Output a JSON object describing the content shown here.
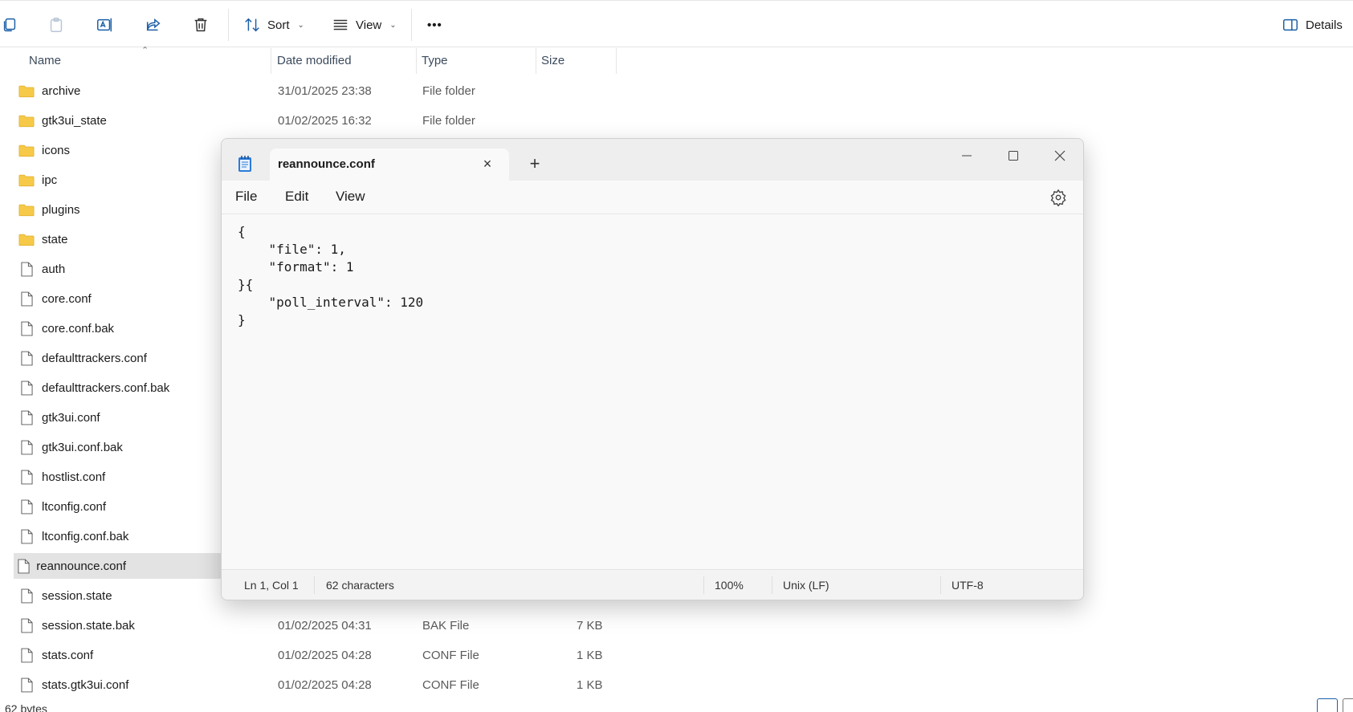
{
  "toolbar": {
    "sort_label": "Sort",
    "view_label": "View",
    "more_label": "•••",
    "details_label": "Details"
  },
  "columns": {
    "name": "Name",
    "date": "Date modified",
    "type": "Type",
    "size": "Size"
  },
  "files": [
    {
      "name": "archive",
      "date": "31/01/2025 23:38",
      "type": "File folder",
      "size": "",
      "kind": "folder"
    },
    {
      "name": "gtk3ui_state",
      "date": "01/02/2025 16:32",
      "type": "File folder",
      "size": "",
      "kind": "folder"
    },
    {
      "name": "icons",
      "date": "",
      "type": "",
      "size": "",
      "kind": "folder"
    },
    {
      "name": "ipc",
      "date": "",
      "type": "",
      "size": "",
      "kind": "folder"
    },
    {
      "name": "plugins",
      "date": "",
      "type": "",
      "size": "",
      "kind": "folder"
    },
    {
      "name": "state",
      "date": "",
      "type": "",
      "size": "",
      "kind": "folder"
    },
    {
      "name": "auth",
      "date": "",
      "type": "",
      "size": "",
      "kind": "file"
    },
    {
      "name": "core.conf",
      "date": "",
      "type": "",
      "size": "",
      "kind": "file"
    },
    {
      "name": "core.conf.bak",
      "date": "",
      "type": "",
      "size": "",
      "kind": "file"
    },
    {
      "name": "defaulttrackers.conf",
      "date": "",
      "type": "",
      "size": "",
      "kind": "file"
    },
    {
      "name": "defaulttrackers.conf.bak",
      "date": "",
      "type": "",
      "size": "",
      "kind": "file"
    },
    {
      "name": "gtk3ui.conf",
      "date": "",
      "type": "",
      "size": "",
      "kind": "file"
    },
    {
      "name": "gtk3ui.conf.bak",
      "date": "",
      "type": "",
      "size": "",
      "kind": "file"
    },
    {
      "name": "hostlist.conf",
      "date": "",
      "type": "",
      "size": "",
      "kind": "file"
    },
    {
      "name": "ltconfig.conf",
      "date": "",
      "type": "",
      "size": "",
      "kind": "file"
    },
    {
      "name": "ltconfig.conf.bak",
      "date": "",
      "type": "",
      "size": "",
      "kind": "file"
    },
    {
      "name": "reannounce.conf",
      "date": "",
      "type": "",
      "size": "",
      "kind": "file",
      "selected": true
    },
    {
      "name": "session.state",
      "date": "",
      "type": "",
      "size": "",
      "kind": "file"
    },
    {
      "name": "session.state.bak",
      "date": "01/02/2025 04:31",
      "type": "BAK File",
      "size": "7 KB",
      "kind": "file"
    },
    {
      "name": "stats.conf",
      "date": "01/02/2025 04:28",
      "type": "CONF File",
      "size": "1 KB",
      "kind": "file"
    },
    {
      "name": "stats.gtk3ui.conf",
      "date": "01/02/2025 04:28",
      "type": "CONF File",
      "size": "1 KB",
      "kind": "file"
    }
  ],
  "explorer_status": "62 bytes",
  "notepad": {
    "tab_title": "reannounce.conf",
    "menu": {
      "file": "File",
      "edit": "Edit",
      "view": "View"
    },
    "content": "{\n    \"file\": 1,\n    \"format\": 1\n}{\n    \"poll_interval\": 120\n}",
    "status": {
      "position": "Ln 1, Col 1",
      "characters": "62 characters",
      "zoom": "100%",
      "line_ending": "Unix (LF)",
      "encoding": "UTF-8"
    }
  },
  "colors": {
    "folder": "#f7c948",
    "accent": "#1c5fa6"
  }
}
